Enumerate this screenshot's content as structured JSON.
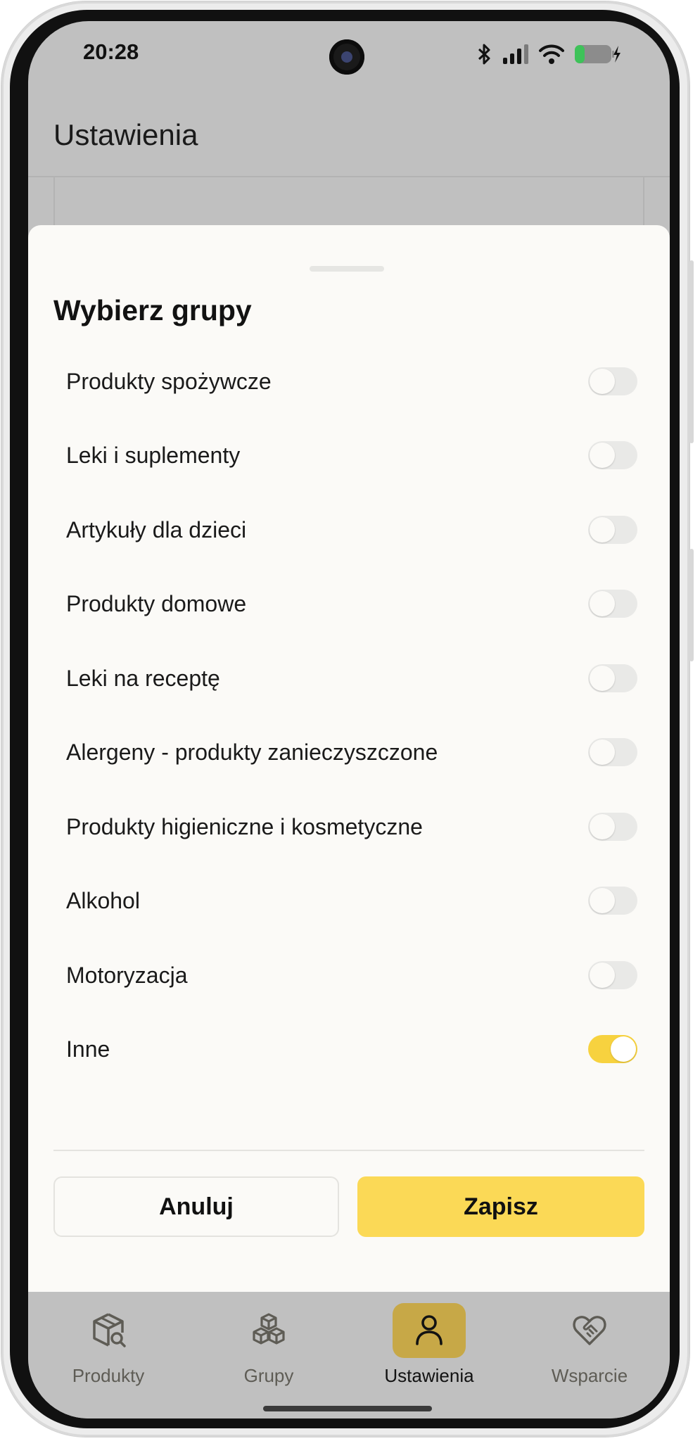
{
  "status_bar": {
    "time": "20:28",
    "icons": [
      "bluetooth-icon",
      "signal-icon",
      "wifi-icon",
      "battery-icon"
    ]
  },
  "app_bar": {
    "title": "Ustawienia"
  },
  "sheet": {
    "title": "Wybierz grupy",
    "groups": [
      {
        "label": "Produkty spożywcze",
        "enabled": false
      },
      {
        "label": "Leki i suplementy",
        "enabled": false
      },
      {
        "label": "Artykuły dla dzieci",
        "enabled": false
      },
      {
        "label": "Produkty domowe",
        "enabled": false
      },
      {
        "label": "Leki na receptę",
        "enabled": false
      },
      {
        "label": "Alergeny - produkty zanieczyszczone",
        "enabled": false
      },
      {
        "label": "Produkty higieniczne i kosmetyczne",
        "enabled": false
      },
      {
        "label": "Alkohol",
        "enabled": false
      },
      {
        "label": "Motoryzacja",
        "enabled": false
      },
      {
        "label": "Inne",
        "enabled": true
      }
    ],
    "cancel_label": "Anuluj",
    "save_label": "Zapisz"
  },
  "bottom_nav": {
    "items": [
      {
        "label": "Produkty",
        "icon": "package-search-icon",
        "active": false
      },
      {
        "label": "Grupy",
        "icon": "boxes-icon",
        "active": false
      },
      {
        "label": "Ustawienia",
        "icon": "user-icon",
        "active": true
      },
      {
        "label": "Wsparcie",
        "icon": "heart-handshake-icon",
        "active": false
      }
    ]
  },
  "colors": {
    "accent": "#FBD956",
    "toggle_on": "#F7D23F",
    "nav_active_pill": "#C7A847",
    "scrim": "#C0C0C0",
    "sheet_bg": "#FBFAF7"
  }
}
